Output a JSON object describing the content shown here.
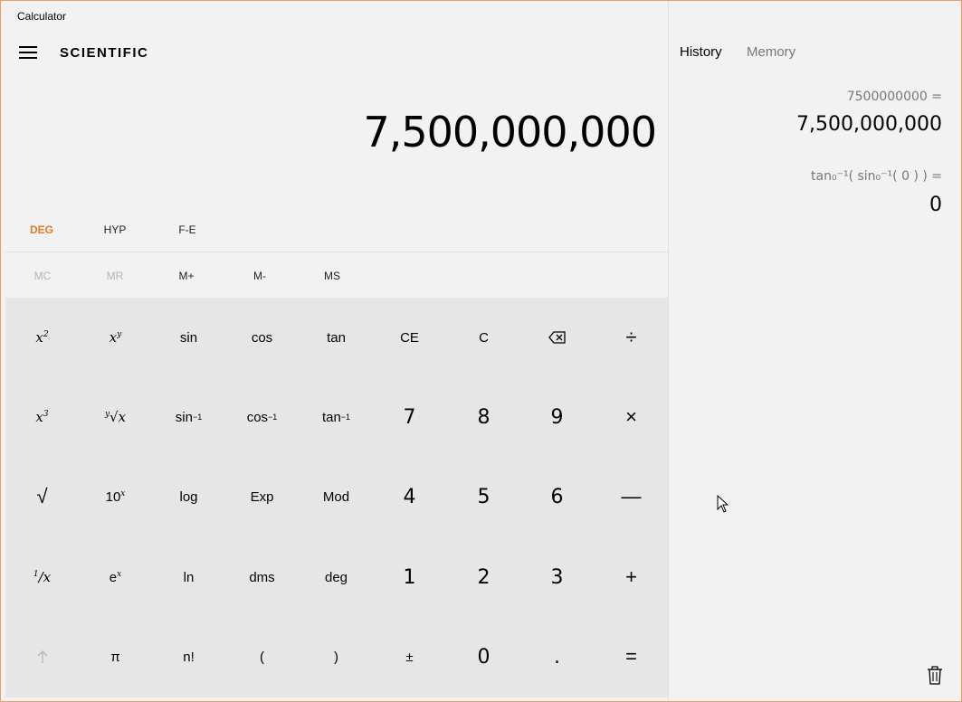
{
  "app": {
    "title": "Calculator",
    "mode": "SCIENTIFIC"
  },
  "display": {
    "value": "7,500,000,000"
  },
  "options": {
    "deg": "DEG",
    "hyp": "HYP",
    "fe": "F-E"
  },
  "memory": {
    "mc": "MC",
    "mr": "MR",
    "mplus": "M+",
    "mminus": "M-",
    "ms": "MS"
  },
  "keys": {
    "sin": "sin",
    "cos": "cos",
    "tan": "tan",
    "ce": "CE",
    "c": "C",
    "n7": "7",
    "n8": "8",
    "n9": "9",
    "log": "log",
    "exp": "Exp",
    "mod": "Mod",
    "n4": "4",
    "n5": "5",
    "n6": "6",
    "ln": "ln",
    "dms": "dms",
    "deg": "deg",
    "n1": "1",
    "n2": "2",
    "n3": "3",
    "pi": "π",
    "fact": "n!",
    "lparen": "(",
    "rparen": ")",
    "plusminus": "±",
    "n0": "0",
    "dot": ".",
    "divide": "÷",
    "multiply": "×",
    "minus": "—",
    "plus": "+",
    "equals": "="
  },
  "panel": {
    "tab_history": "History",
    "tab_memory": "Memory"
  },
  "history": [
    {
      "expression": "7500000000 =",
      "result": "7,500,000,000"
    },
    {
      "expression": "tan₀⁻¹( sin₀⁻¹( 0 ) ) =",
      "result": "0"
    }
  ],
  "colors": {
    "accent": "#e07b26",
    "keypad_bg": "#e6e6e6",
    "window_border": "#e8a06a"
  }
}
